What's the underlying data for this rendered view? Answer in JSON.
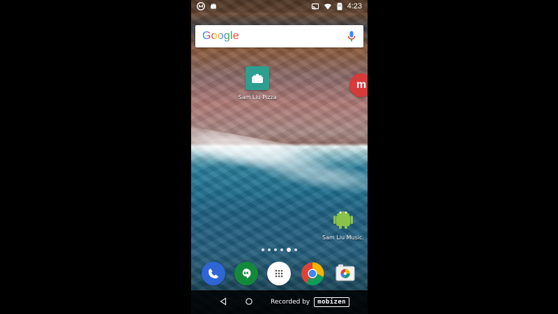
{
  "status_bar": {
    "time": "4:23",
    "left_icons": [
      "mobizen-icon",
      "android-notification-icon"
    ],
    "right_icons": [
      "cast-icon",
      "wifi-icon",
      "battery-icon"
    ]
  },
  "search": {
    "label": "Google",
    "voice_icon": "mic-icon"
  },
  "apps": [
    {
      "label": "Sam Liu Pizza"
    },
    {
      "label": "Sam Liu Music."
    }
  ],
  "partial_app": {
    "letter": "m"
  },
  "dock": {
    "items": [
      "phone-icon",
      "hangouts-icon",
      "app-drawer-icon",
      "chrome-icon",
      "camera-icon"
    ]
  },
  "nav_bar": {
    "recorded_text": "Recorded by",
    "brand": "mobizen"
  }
}
